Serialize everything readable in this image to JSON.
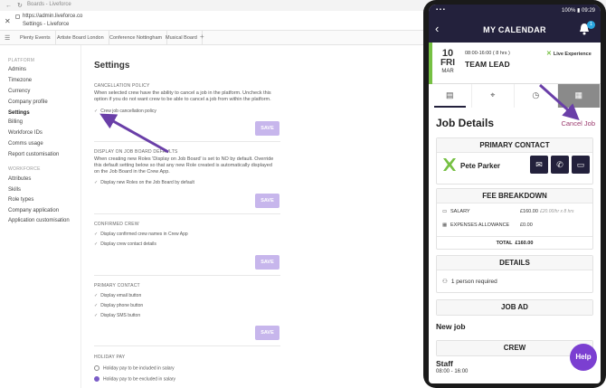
{
  "browser": {
    "tab_title": "Boards - Liveforce",
    "url": "https://admin.liveforce.co",
    "page_title": "Settings - Liveforce",
    "tabs": [
      "Plenty Events",
      "Artiste Board London",
      "Conference Nottingham",
      "Musical Board"
    ]
  },
  "sidebar": {
    "platform_heading": "PLATFORM",
    "platform_items": [
      "Admins",
      "Timezone",
      "Currency",
      "Company profile",
      "Settings",
      "Billing",
      "Workforce IDs",
      "Comms usage",
      "Report customisation"
    ],
    "workforce_heading": "WORKFORCE",
    "workforce_items": [
      "Attributes",
      "Skills",
      "Role types",
      "Company application",
      "Application customisation"
    ],
    "active": "Settings"
  },
  "settings": {
    "title": "Settings",
    "save_label": "SAVE",
    "cancellation": {
      "heading": "CANCELLATION POLICY",
      "desc": "When selected crew have the ability to cancel a job in the platform. Uncheck this option if you do not want crew to be able to cancel a job from within the platform.",
      "options": [
        "Crew job cancellation policy"
      ]
    },
    "display_board": {
      "heading": "DISPLAY ON JOB BOARD DEFAULTS",
      "desc": "When creating new Roles 'Display on Job Board' is set to NO by default. Override this default setting below so that any new Role created is automatically displayed on the Job Board in the Crew App.",
      "options": [
        "Display new Roles on the Job Board by default"
      ]
    },
    "confirmed_crew": {
      "heading": "CONFIRMED CREW",
      "options": [
        "Display confirmed crew names in Crew App",
        "Display crew contact details"
      ]
    },
    "primary_contact": {
      "heading": "PRIMARY CONTACT",
      "options": [
        "Display email button",
        "Display phone button",
        "Display SMS button"
      ]
    },
    "holiday_pay": {
      "heading": "HOLIDAY PAY",
      "options": [
        "Holiday pay to be included in salary",
        "Holiday pay to be excluded in salary"
      ],
      "selected": 1
    }
  },
  "phone": {
    "status_left": "▪ ▪ ▪",
    "status_battery": "100%",
    "status_time": "09:29",
    "header_title": "MY CALENDAR",
    "bell_badge": "1",
    "job": {
      "day": "10",
      "weekday": "FRI",
      "month": "MAR",
      "time": "08:00-16:00 ( 8 hrs )",
      "role": "TEAM LEAD",
      "brand": "Live Experience"
    },
    "details_title": "Job Details",
    "cancel_label": "Cancel Job",
    "primary_contact": {
      "title": "PRIMARY CONTACT",
      "name": "Pete Parker"
    },
    "fee": {
      "title": "FEE BREAKDOWN",
      "rows": [
        {
          "label": "SALARY",
          "value": "£160.00",
          "sub": "£20.00/hr x 8 hrs"
        },
        {
          "label": "EXPENSES ALLOWANCE",
          "value": "£0.00",
          "sub": ""
        }
      ],
      "total_label": "TOTAL",
      "total_value": "£160.00"
    },
    "details": {
      "title": "DETAILS",
      "required": "1 person required"
    },
    "job_ad": {
      "title": "JOB AD",
      "text": "New job"
    },
    "crew": {
      "title": "CREW",
      "name": "Staff",
      "time": "08:00 - 16:00"
    },
    "help_label": "Help"
  },
  "colors": {
    "phone_header": "#23213c",
    "save_button": "#c7b6ec",
    "accent_purple": "#7b3fd1",
    "arrow_purple": "#6a3fa8",
    "cancel_text": "#9b3a6e",
    "job_green": "#76c043"
  }
}
